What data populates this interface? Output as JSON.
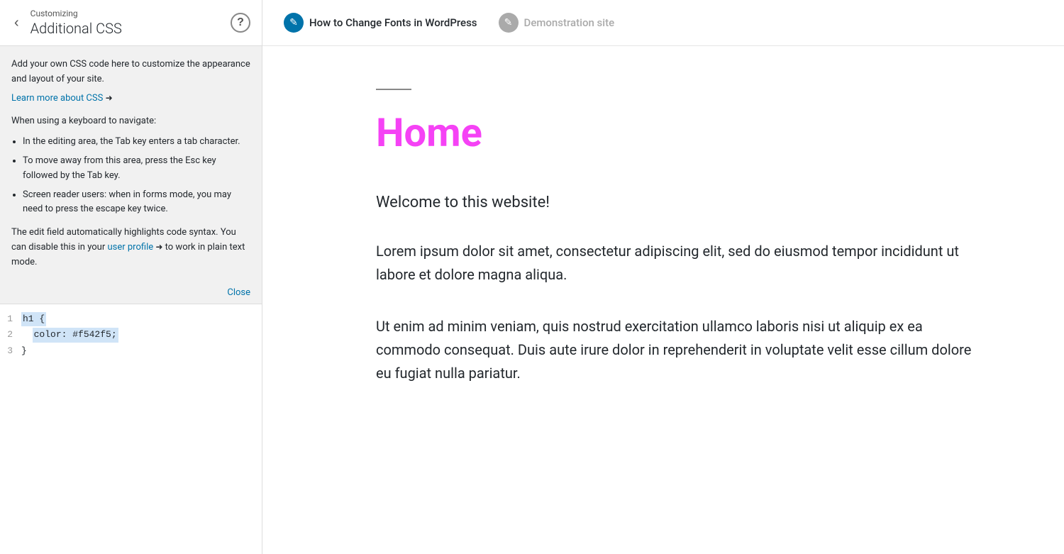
{
  "leftPanel": {
    "customizingLabel": "Customizing",
    "title": "Additional CSS",
    "helpLabel": "?",
    "backArrow": "‹",
    "infoText1": "Add your own CSS code here to customize the appearance and layout of your site.",
    "learnMoreLink": "Learn more about CSS",
    "keyboardLabel": "When using a keyboard to navigate:",
    "bulletPoints": [
      "In the editing area, the Tab key enters a tab character.",
      "To move away from this area, press the Esc key followed by the Tab key.",
      "Screen reader users: when in forms mode, you may need to press the escape key twice."
    ],
    "editFieldNote1": "The edit field automatically highlights code syntax. You can disable this in your",
    "userProfileLink": "user profile",
    "editFieldNote2": "to work in plain text mode.",
    "closeLabel": "Close",
    "codeLines": [
      {
        "num": "1",
        "text": "h1 {"
      },
      {
        "num": "2",
        "text": "  color: #f542f5;"
      },
      {
        "num": "3",
        "text": "}"
      }
    ]
  },
  "previewToolbar": {
    "link1Text": "How to Change Fonts in WordPress",
    "link2Text": "Demonstration site",
    "editIconSymbol": "✎"
  },
  "previewContent": {
    "heading": "Home",
    "subtitle": "Welcome to this website!",
    "body1": "Lorem ipsum dolor sit amet, consectetur adipiscing elit, sed do eiusmod tempor incididunt ut labore et dolore magna aliqua.",
    "body2": "Ut enim ad minim veniam, quis nostrud exercitation ullamco laboris nisi ut aliquip ex ea commodo consequat. Duis aute irure dolor in reprehenderit in voluptate velit esse cillum dolore eu fugiat nulla pariatur."
  },
  "colors": {
    "accent": "#0073aa",
    "headingColor": "#f542f5",
    "editIconBg": "#0073aa"
  }
}
